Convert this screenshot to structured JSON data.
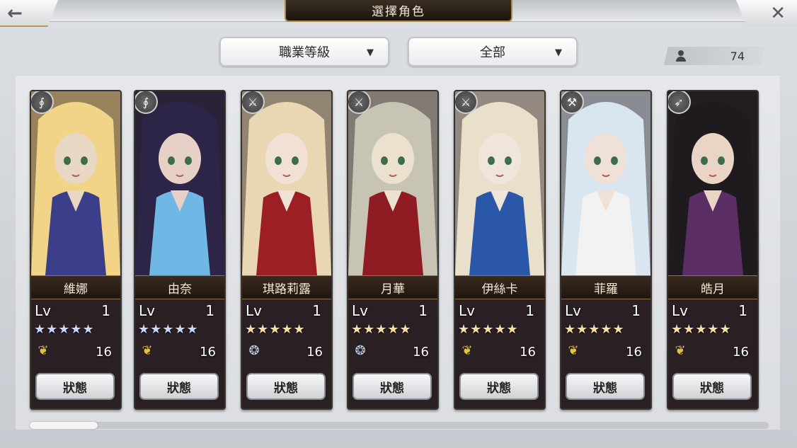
{
  "header": {
    "title": "選擇角色",
    "back_icon": "←",
    "close_icon": "✕"
  },
  "filters": {
    "job_level": "職業等級",
    "category": "全部",
    "caret": "▼"
  },
  "counter": {
    "value": "74"
  },
  "scroll": {
    "position": 0.0
  },
  "characters": [
    {
      "name": "維娜",
      "lv_label": "Lv",
      "level": "1",
      "stars": "★★★★★",
      "star_color": "#c8d8ff",
      "element": "wing",
      "element_glyph": "❦",
      "count": "16",
      "status": "狀態",
      "class_glyph": "∮",
      "palette": [
        "#f1d488",
        "#3b3f8a",
        "#e8d7c3"
      ]
    },
    {
      "name": "由奈",
      "lv_label": "Lv",
      "level": "1",
      "stars": "★★★★★",
      "star_color": "#c8d8ff",
      "element": "wing",
      "element_glyph": "❦",
      "count": "16",
      "status": "狀態",
      "class_glyph": "∮",
      "palette": [
        "#2c2548",
        "#6fb8e6",
        "#e7d1c7"
      ]
    },
    {
      "name": "琪路莉露",
      "lv_label": "Lv",
      "level": "1",
      "stars": "★★★★★",
      "star_color": "#f5e2a2",
      "element": "wind",
      "element_glyph": "❂",
      "count": "16",
      "status": "狀態",
      "class_glyph": "⚔",
      "palette": [
        "#e8d7b2",
        "#9c1f26",
        "#f1e1d4"
      ]
    },
    {
      "name": "月華",
      "lv_label": "Lv",
      "level": "1",
      "stars": "★★★★★",
      "star_color": "#f5e2a2",
      "element": "wind",
      "element_glyph": "❂",
      "count": "16",
      "status": "狀態",
      "class_glyph": "⚔",
      "palette": [
        "#c8c4b4",
        "#8e1c22",
        "#ece0cf"
      ]
    },
    {
      "name": "伊絲卡",
      "lv_label": "Lv",
      "level": "1",
      "stars": "★★★★★",
      "star_color": "#f5e2a2",
      "element": "wing",
      "element_glyph": "❦",
      "count": "16",
      "status": "狀態",
      "class_glyph": "⚔",
      "palette": [
        "#e9e0cc",
        "#2b57a8",
        "#f0e5da"
      ]
    },
    {
      "name": "菲羅",
      "lv_label": "Lv",
      "level": "1",
      "stars": "★★★★★",
      "star_color": "#f5e2a2",
      "element": "wing",
      "element_glyph": "❦",
      "count": "16",
      "status": "狀態",
      "class_glyph": "⚒",
      "palette": [
        "#d9e6ef",
        "#f2f2f2",
        "#efe1d6"
      ]
    },
    {
      "name": "皓月",
      "lv_label": "Lv",
      "level": "1",
      "stars": "★★★★★",
      "star_color": "#f5e2a2",
      "element": "wing",
      "element_glyph": "❦",
      "count": "16",
      "status": "狀態",
      "class_glyph": "➶",
      "palette": [
        "#1e1a1e",
        "#5b2e66",
        "#ead4c6"
      ]
    }
  ]
}
